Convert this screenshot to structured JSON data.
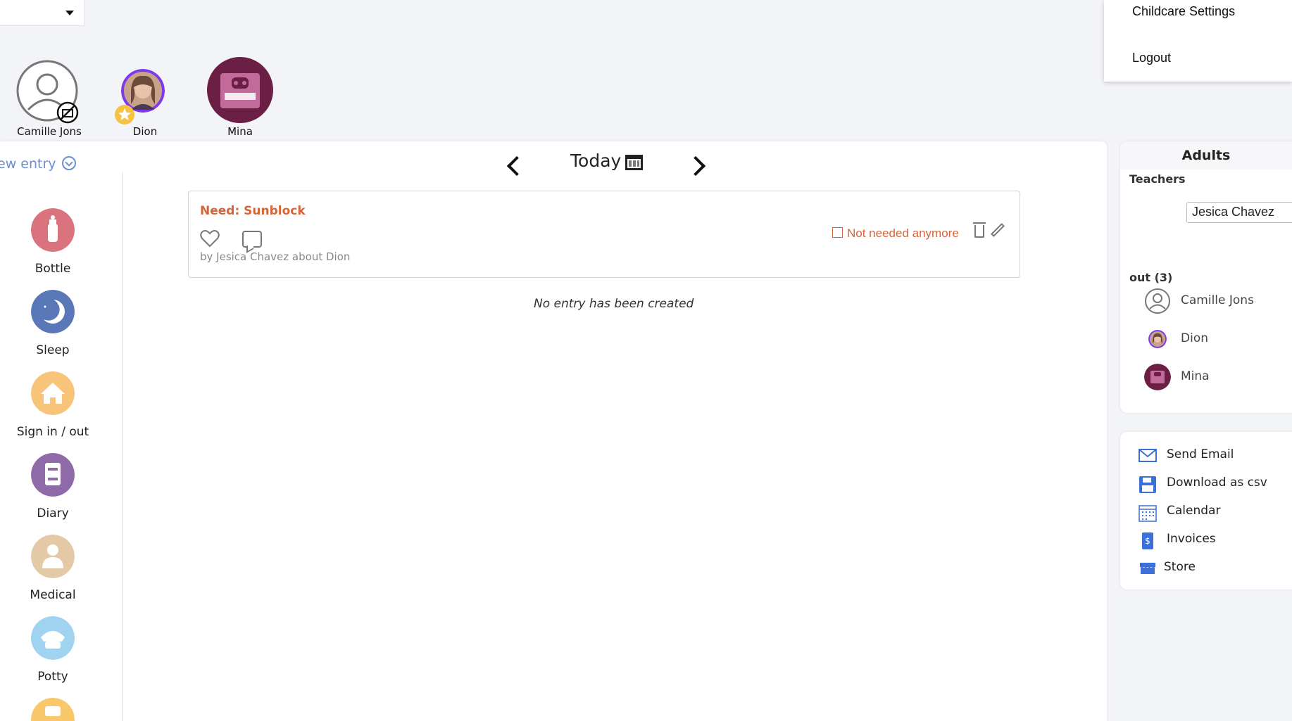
{
  "menu": {
    "items": [
      "Childcare Settings",
      "Logout"
    ]
  },
  "children": [
    {
      "name": "Camille Jons"
    },
    {
      "name": "Dion"
    },
    {
      "name": "Mina"
    }
  ],
  "sidebar": {
    "new_entry_label": "ew entry",
    "categories": [
      {
        "label": "Bottle",
        "icon": "bottle-icon",
        "color": "#d9737e"
      },
      {
        "label": "Sleep",
        "icon": "moon-icon",
        "color": "#5a78b8"
      },
      {
        "label": "Sign in / out",
        "icon": "house-icon",
        "color": "#f7c47a"
      },
      {
        "label": "Diary",
        "icon": "diary-icon",
        "color": "#8e6aa8"
      },
      {
        "label": "Medical",
        "icon": "doctor-icon",
        "color": "#e4c9a6"
      },
      {
        "label": "Potty",
        "icon": "potty-icon",
        "color": "#9fd3ef"
      }
    ]
  },
  "date_nav": {
    "label": "Today"
  },
  "entry": {
    "title": "Need: Sunblock",
    "byline": "by Jesica Chavez about Dion",
    "not_needed_label": "Not needed anymore"
  },
  "empty_message": "No entry has been created",
  "adults": {
    "heading": "Adults",
    "teachers_label": "Teachers",
    "teacher_selected": "Jesica Chavez",
    "out_label": "out (3)",
    "out_list": [
      "Camille Jons",
      "Dion",
      "Mina"
    ]
  },
  "actions": [
    {
      "label": "Send Email",
      "icon": "mail-icon"
    },
    {
      "label": "Download as csv",
      "icon": "save-icon"
    },
    {
      "label": "Calendar",
      "icon": "calendar-icon"
    },
    {
      "label": "Invoices",
      "icon": "invoice-icon"
    },
    {
      "label": "Store",
      "icon": "store-icon"
    }
  ],
  "colors": {
    "accent": "#d4653a",
    "link": "#6a8fd0",
    "purple": "#7c3aed",
    "mina": "#6b1f45"
  }
}
